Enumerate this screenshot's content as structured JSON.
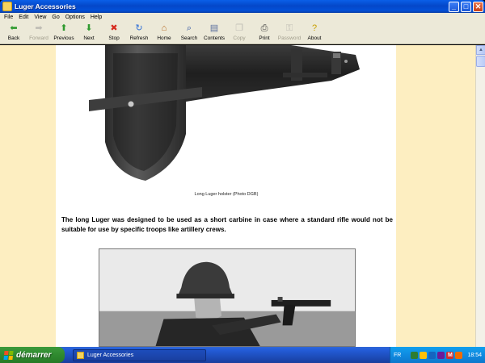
{
  "window": {
    "title": "Luger Accessories",
    "controls": {
      "minimize": "_",
      "maximize": "□",
      "close": "✕"
    }
  },
  "menu": [
    "File",
    "Edit",
    "View",
    "Go",
    "Options",
    "Help"
  ],
  "toolbar": [
    {
      "label": "Back",
      "icon": "back-arrow-icon",
      "glyph": "⬅",
      "color": "#2f9a2f",
      "enabled": true
    },
    {
      "label": "Forward",
      "icon": "forward-arrow-icon",
      "glyph": "➡",
      "color": "#8a8a8a",
      "enabled": false
    },
    {
      "label": "Previous",
      "icon": "previous-arrow-icon",
      "glyph": "⬆",
      "color": "#2f9a2f",
      "enabled": true
    },
    {
      "label": "Next",
      "icon": "next-arrow-icon",
      "glyph": "⬇",
      "color": "#2f9a2f",
      "enabled": true
    },
    {
      "label": "Stop",
      "icon": "stop-icon",
      "glyph": "✖",
      "color": "#d62b1f",
      "enabled": true
    },
    {
      "label": "Refresh",
      "icon": "refresh-icon",
      "glyph": "↻",
      "color": "#2f6fd6",
      "enabled": true
    },
    {
      "label": "Home",
      "icon": "home-icon",
      "glyph": "⌂",
      "color": "#b5651d",
      "enabled": true
    },
    {
      "label": "Search",
      "icon": "search-icon",
      "glyph": "⌕",
      "color": "#2a4f9e",
      "enabled": true
    },
    {
      "label": "Contents",
      "icon": "contents-icon",
      "glyph": "▤",
      "color": "#5a6f9e",
      "enabled": true
    },
    {
      "label": "Copy",
      "icon": "copy-icon",
      "glyph": "❐",
      "color": "#8a8a8a",
      "enabled": false
    },
    {
      "label": "Print",
      "icon": "print-icon",
      "glyph": "⎙",
      "color": "#444444",
      "enabled": true
    },
    {
      "label": "Password",
      "icon": "key-icon",
      "glyph": "⚿",
      "color": "#8a8a8a",
      "enabled": false
    },
    {
      "label": "About",
      "icon": "about-icon",
      "glyph": "?",
      "color": "#c9a000",
      "enabled": true
    }
  ],
  "page": {
    "caption": "Long Luger holster (Photo DGB)",
    "paragraph": "The long Luger was designed to be used as a short carbine in case where a standard rifle would not be suitable for use by specific troops like artillery crews.",
    "colors": {
      "side_background": "#fdeec1",
      "content_background": "#ffffff"
    }
  },
  "scrollbar": {
    "up": "▲"
  },
  "taskbar": {
    "start_label": "démarrer",
    "task_label": "Luger Accessories",
    "language": "FR",
    "clock": "18:54"
  }
}
